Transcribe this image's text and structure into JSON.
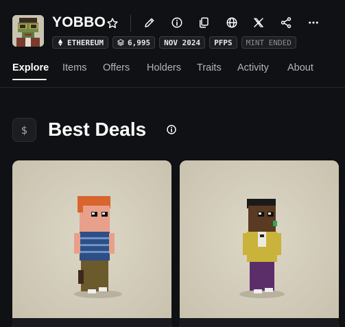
{
  "collection": {
    "name": "YOBBO",
    "avatar_icon": "yobbo-pixel-avatar"
  },
  "header_actions": [
    {
      "name": "edit",
      "icon": "pencil-icon"
    },
    {
      "name": "info",
      "icon": "info-icon"
    },
    {
      "name": "copy",
      "icon": "copy-icon"
    },
    {
      "name": "website",
      "icon": "globe-icon"
    },
    {
      "name": "x",
      "icon": "x-logo-icon"
    },
    {
      "name": "share",
      "icon": "share-icon"
    },
    {
      "name": "more",
      "icon": "ellipsis-icon"
    }
  ],
  "tags": {
    "chain": "ETHEREUM",
    "supply": "6,995",
    "date": "NOV 2024",
    "category": "PFPS",
    "mint_status": "MINT ENDED"
  },
  "tabs": [
    "Explore",
    "Items",
    "Offers",
    "Holders",
    "Traits",
    "Activity",
    "About"
  ],
  "active_tab": "Explore",
  "section": {
    "icon": "dollar-icon",
    "glyph": "$",
    "title": "Best Deals"
  },
  "colors": {
    "background": "#101114",
    "card_background": "#d6d0bf",
    "tag_border": "#3c3d42"
  }
}
